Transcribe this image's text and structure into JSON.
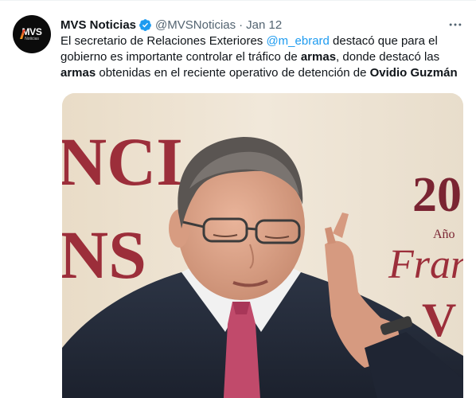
{
  "tweet": {
    "display_name": "MVS Noticias",
    "handle": "@MVSNoticias",
    "separator": "·",
    "date": "Jan 12",
    "more_icon": "ellipsis-icon",
    "verified_icon": "verified-badge-icon",
    "avatar": {
      "text": "MVS",
      "subtext": "Noticias",
      "background": "#0b0b0b"
    },
    "text_parts": {
      "p1": "El secretario de Relaciones Exteriores ",
      "mention": "@m_ebrard",
      "p2": " destacó que para el gobierno es importante controlar el tráfico de ",
      "b1": "armas",
      "p3": ", donde destacó las ",
      "b2": "armas",
      "p4": " obtenidas en el reciente operativo de detención de ",
      "b3": "Ovidio Guzmán"
    },
    "media": {
      "background_letters_left": [
        "NCI",
        "NS"
      ],
      "background_letters_right": [
        "20",
        "Año",
        "Fran",
        "V"
      ]
    },
    "colors": {
      "link": "#1d9bf0",
      "text": "#0f1419",
      "secondary": "#536471",
      "backdrop_text": "#9c2e3a"
    }
  }
}
